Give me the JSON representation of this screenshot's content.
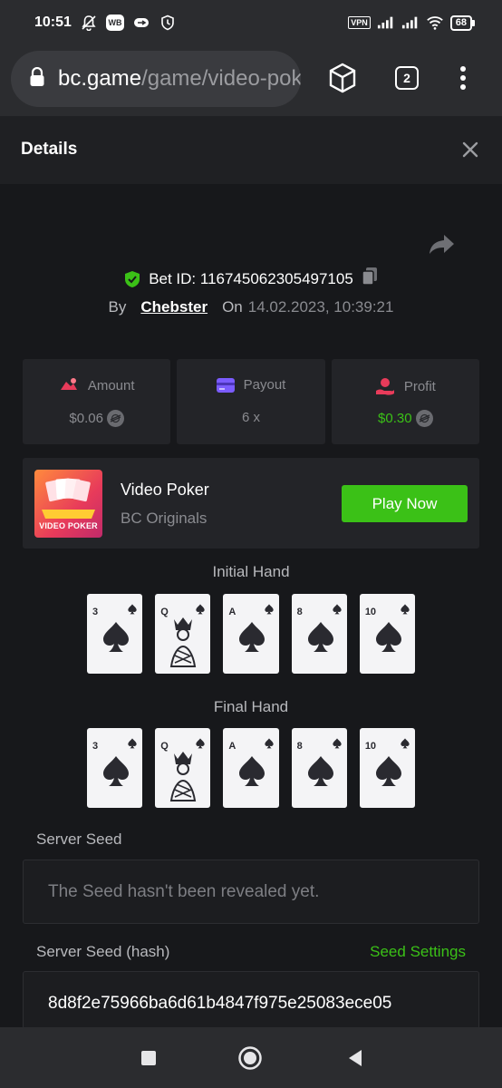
{
  "status_bar": {
    "time": "10:51",
    "wb_badge": "WB",
    "vpn_label": "VPN",
    "battery": "68"
  },
  "browser": {
    "url_domain": "bc.game",
    "url_path": "/game/video-poker",
    "tab_count": "2"
  },
  "details": {
    "title": "Details"
  },
  "bet": {
    "bet_id_label": "Bet ID: 116745062305497105",
    "by_label": "By",
    "username": "Chebster",
    "on_label": "On",
    "date": "14.02.2023, 10:39:21"
  },
  "stats": [
    {
      "label": "Amount",
      "value": "$0.06",
      "icon": "amount-icon",
      "value_color": "#8a8b90"
    },
    {
      "label": "Payout",
      "value": "6 x",
      "icon": "payout-icon",
      "value_color": "#8a8b90"
    },
    {
      "label": "Profit",
      "value": "$0.30",
      "icon": "profit-icon",
      "value_color": "#3bc117"
    }
  ],
  "game": {
    "title": "Video Poker",
    "subtitle": "BC Originals",
    "thumb_text": "VIDEO POKER",
    "play_label": "Play Now"
  },
  "hands": {
    "initial_title": "Initial Hand",
    "final_title": "Final Hand",
    "initial": [
      "3",
      "Q",
      "A",
      "8",
      "10"
    ],
    "final": [
      "3",
      "Q",
      "A",
      "8",
      "10"
    ],
    "suit": "spades"
  },
  "server_seed": {
    "label": "Server Seed",
    "value": "The Seed hasn't been revealed yet."
  },
  "server_seed_hash": {
    "label": "Server Seed (hash)",
    "settings_label": "Seed Settings",
    "value": "8d8f2e75966ba6d61b4847f975e25083ece05"
  },
  "colors": {
    "accent_green": "#3bc117",
    "background": "#17181b",
    "panel": "#232428"
  }
}
